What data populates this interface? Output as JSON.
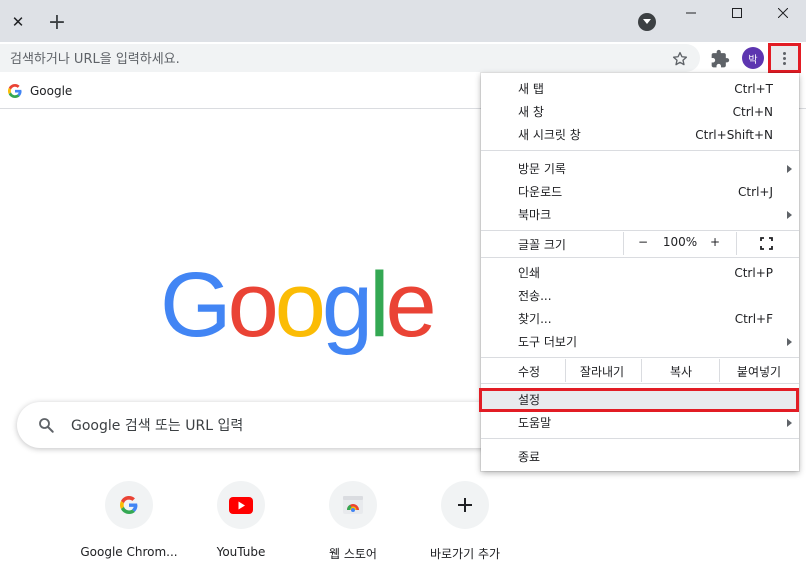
{
  "titlebar": {
    "tab_close_glyph": "✕",
    "new_tab_glyph": "+",
    "tab_search_icon": "chevron-down-icon",
    "window_controls": [
      "minimize-icon",
      "maximize-icon",
      "close-icon"
    ]
  },
  "toolbar": {
    "omnibox_placeholder": "검색하거나 URL을 입력하세요.",
    "avatar_initial": "박"
  },
  "bookmarks": {
    "items": [
      {
        "label": "Google",
        "icon": "google-g-icon"
      }
    ]
  },
  "ntp": {
    "logo_text": "Google",
    "search_placeholder": "Google 검색 또는 URL 입력",
    "shortcuts": [
      {
        "label": "Google Chrom...",
        "icon": "google-g-icon"
      },
      {
        "label": "YouTube",
        "icon": "youtube-icon"
      },
      {
        "label": "웹 스토어",
        "icon": "web-store-icon"
      },
      {
        "label": "바로가기 추가",
        "icon": "plus-icon"
      }
    ]
  },
  "menu": {
    "new_tab": {
      "label": "새 탭",
      "shortcut": "Ctrl+T"
    },
    "new_window": {
      "label": "새 창",
      "shortcut": "Ctrl+N"
    },
    "incognito": {
      "label": "새 시크릿 창",
      "shortcut": "Ctrl+Shift+N"
    },
    "history": {
      "label": "방문 기록"
    },
    "downloads": {
      "label": "다운로드",
      "shortcut": "Ctrl+J"
    },
    "bookmarks": {
      "label": "북마크"
    },
    "zoom": {
      "label": "글꼴 크기",
      "minus": "−",
      "value": "100%",
      "plus": "+"
    },
    "print": {
      "label": "인쇄",
      "shortcut": "Ctrl+P"
    },
    "cast": {
      "label": "전송..."
    },
    "find": {
      "label": "찾기...",
      "shortcut": "Ctrl+F"
    },
    "more_tools": {
      "label": "도구 더보기"
    },
    "edit": {
      "label": "수정",
      "cut": "잘라내기",
      "copy": "복사",
      "paste": "붙여넣기"
    },
    "settings": {
      "label": "설정"
    },
    "help": {
      "label": "도움말"
    },
    "exit": {
      "label": "종료"
    }
  },
  "colors": {
    "highlight": "#e21c24",
    "avatar": "#5d35b0",
    "google_blue": "#4285f4",
    "google_red": "#ea4335",
    "google_yellow": "#fbbc05",
    "google_green": "#34a853"
  }
}
